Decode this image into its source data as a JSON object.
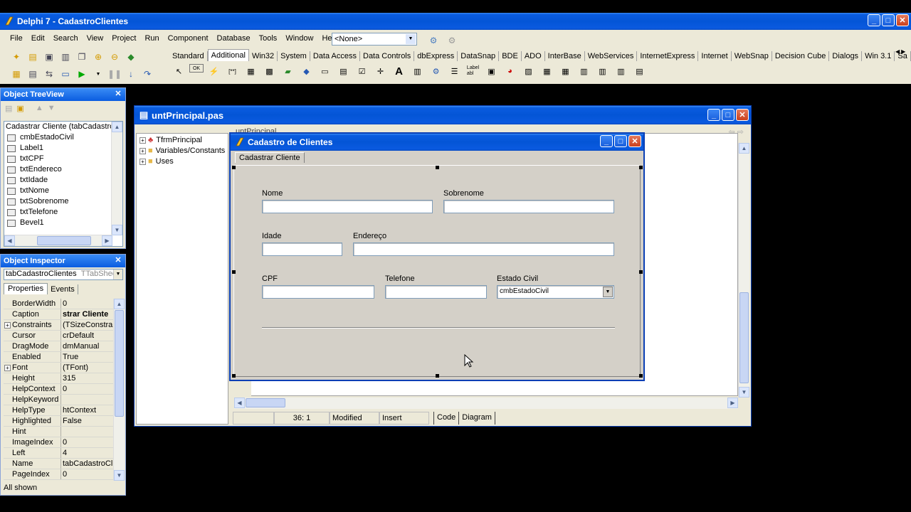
{
  "main_window": {
    "title": "Delphi 7 - CadastroClientes",
    "menu": [
      "File",
      "Edit",
      "Search",
      "View",
      "Project",
      "Run",
      "Component",
      "Database",
      "Tools",
      "Window",
      "Help"
    ],
    "config_combo": "<None>",
    "palette_tabs": [
      "Standard",
      "Additional",
      "Win32",
      "System",
      "Data Access",
      "Data Controls",
      "dbExpress",
      "DataSnap",
      "BDE",
      "ADO",
      "InterBase",
      "WebServices",
      "InternetExpress",
      "Internet",
      "WebSnap",
      "Decision Cube",
      "Dialogs",
      "Win 3.1",
      "Sa"
    ],
    "active_palette_tab": "Additional"
  },
  "object_treeview": {
    "title": "Object TreeView",
    "items": [
      "Cadastrar Cliente (tabCadastroClie",
      "cmbEstadoCivil",
      "Label1",
      "txtCPF",
      "txtEndereco",
      "txtIdade",
      "txtNome",
      "txtSobrenome",
      "txtTelefone",
      "Bevel1"
    ]
  },
  "object_inspector": {
    "title": "Object Inspector",
    "selected_object": "tabCadastroClientes",
    "selected_type": "TTabSheet",
    "tabs": [
      "Properties",
      "Events"
    ],
    "rows": [
      {
        "k": "BorderWidth",
        "v": "0",
        "exp": false
      },
      {
        "k": "Caption",
        "v": "strar Cliente",
        "exp": false
      },
      {
        "k": "Constraints",
        "v": "(TSizeConstrain",
        "exp": true
      },
      {
        "k": "Cursor",
        "v": "crDefault",
        "exp": false
      },
      {
        "k": "DragMode",
        "v": "dmManual",
        "exp": false
      },
      {
        "k": "Enabled",
        "v": "True",
        "exp": false
      },
      {
        "k": "Font",
        "v": "(TFont)",
        "exp": true
      },
      {
        "k": "Height",
        "v": "315",
        "exp": false
      },
      {
        "k": "HelpContext",
        "v": "0",
        "exp": false
      },
      {
        "k": "HelpKeyword",
        "v": "",
        "exp": false
      },
      {
        "k": "HelpType",
        "v": "htContext",
        "exp": false
      },
      {
        "k": "Highlighted",
        "v": "False",
        "exp": false
      },
      {
        "k": "Hint",
        "v": "",
        "exp": false
      },
      {
        "k": "ImageIndex",
        "v": "0",
        "exp": false
      },
      {
        "k": "Left",
        "v": "4",
        "exp": false
      },
      {
        "k": "Name",
        "v": "tabCadastroClie",
        "exp": false
      },
      {
        "k": "PageIndex",
        "v": "0",
        "exp": false
      }
    ],
    "footer": "All shown"
  },
  "editor_window": {
    "title": "untPrincipal.pas",
    "code_tab": "untPrincipal",
    "explorer": [
      "TfrmPrincipal",
      "Variables/Constants",
      "Uses"
    ],
    "status": {
      "pos": "36:  1",
      "modified": "Modified",
      "mode": "Insert"
    },
    "bottom_tabs": [
      "Code",
      "Diagram"
    ]
  },
  "form": {
    "title": "Cadastro de Clientes",
    "tab": "Cadastrar Cliente",
    "labels": {
      "nome": "Nome",
      "sobrenome": "Sobrenome",
      "idade": "Idade",
      "endereco": "Endereço",
      "cpf": "CPF",
      "telefone": "Telefone",
      "estado_civil": "Estado Civil"
    },
    "combo_value": "cmbEstadoCivil"
  }
}
